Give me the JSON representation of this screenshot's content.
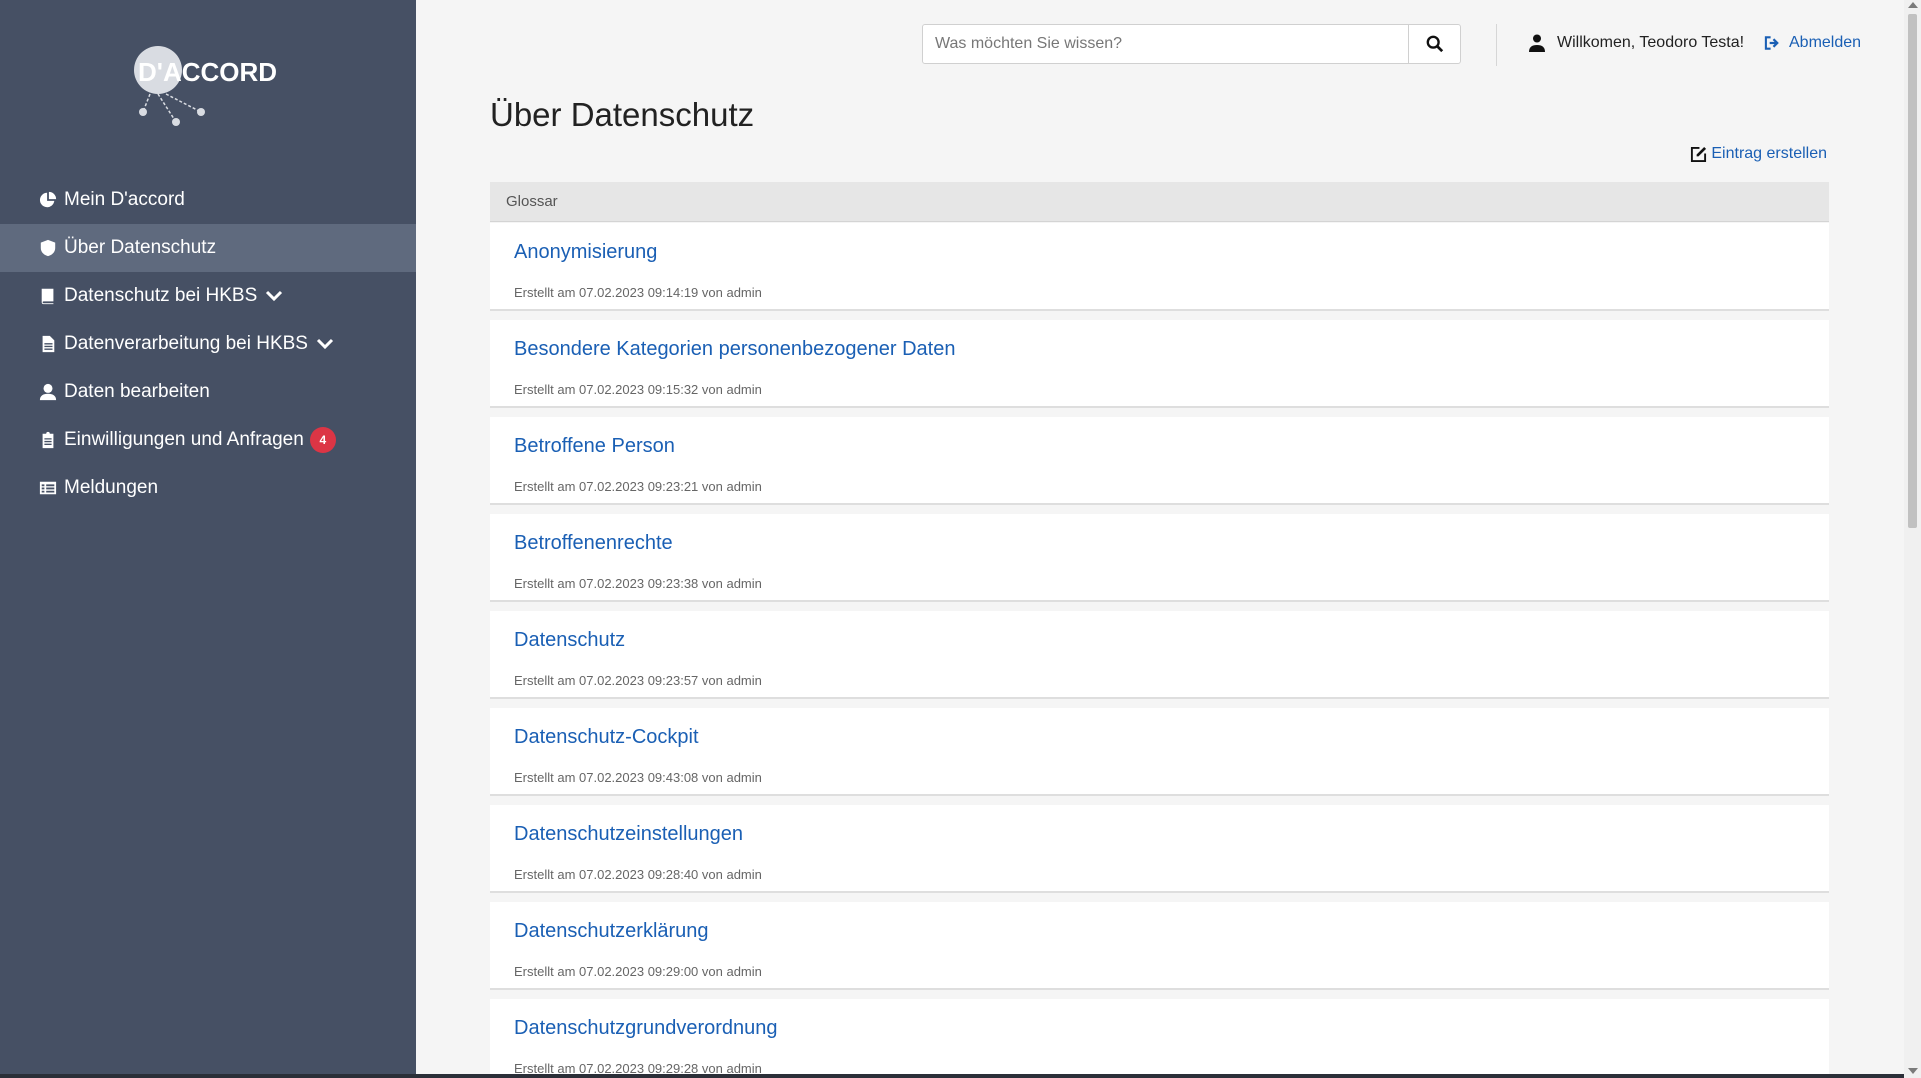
{
  "brand": {
    "logo_text": "D'ACCORD"
  },
  "sidebar": {
    "items": [
      {
        "label": "Mein D'accord",
        "icon": "pie-chart-icon",
        "active": false
      },
      {
        "label": "Über Datenschutz",
        "icon": "shield-icon",
        "active": true
      },
      {
        "label": "Datenschutz bei HKBS",
        "icon": "book-icon",
        "active": false,
        "has_dropdown": true
      },
      {
        "label": "Datenverarbeitung bei HKBS",
        "icon": "document-icon",
        "active": false,
        "has_dropdown": true
      },
      {
        "label": "Daten bearbeiten",
        "icon": "user-icon",
        "active": false
      },
      {
        "label": "Einwilligungen und Anfragen",
        "icon": "clipboard-icon",
        "active": false,
        "badge": "4"
      },
      {
        "label": "Meldungen",
        "icon": "list-icon",
        "active": false
      }
    ]
  },
  "header": {
    "search_placeholder": "Was möchten Sie wissen?",
    "welcome": "Willkomen, Teodoro Testa!",
    "logout": "Abmelden"
  },
  "main": {
    "title": "Über Datenschutz",
    "create_entry": "Eintrag erstellen",
    "section_label": "Glossar",
    "entries": [
      {
        "title": "Anonymisierung",
        "meta": "Erstellt am 07.02.2023 09:14:19 von admin"
      },
      {
        "title": "Besondere Kategorien personenbezogener Daten",
        "meta": "Erstellt am 07.02.2023 09:15:32 von admin"
      },
      {
        "title": "Betroffene Person",
        "meta": "Erstellt am 07.02.2023 09:23:21 von admin"
      },
      {
        "title": "Betroffenenrechte",
        "meta": "Erstellt am 07.02.2023 09:23:38 von admin"
      },
      {
        "title": "Datenschutz",
        "meta": "Erstellt am 07.02.2023 09:23:57 von admin"
      },
      {
        "title": "Datenschutz-Cockpit",
        "meta": "Erstellt am 07.02.2023 09:43:08 von admin"
      },
      {
        "title": "Datenschutzeinstellungen",
        "meta": "Erstellt am 07.02.2023 09:28:40 von admin"
      },
      {
        "title": "Datenschutzerklärung",
        "meta": "Erstellt am 07.02.2023 09:29:00 von admin"
      },
      {
        "title": "Datenschutzgrundverordnung",
        "meta": "Erstellt am 07.02.2023 09:29:28 von admin"
      }
    ]
  },
  "colors": {
    "sidebar_bg": "#465064",
    "sidebar_active": "#5f6a7e",
    "link": "#1a5fb4",
    "badge": "#dc3545"
  }
}
